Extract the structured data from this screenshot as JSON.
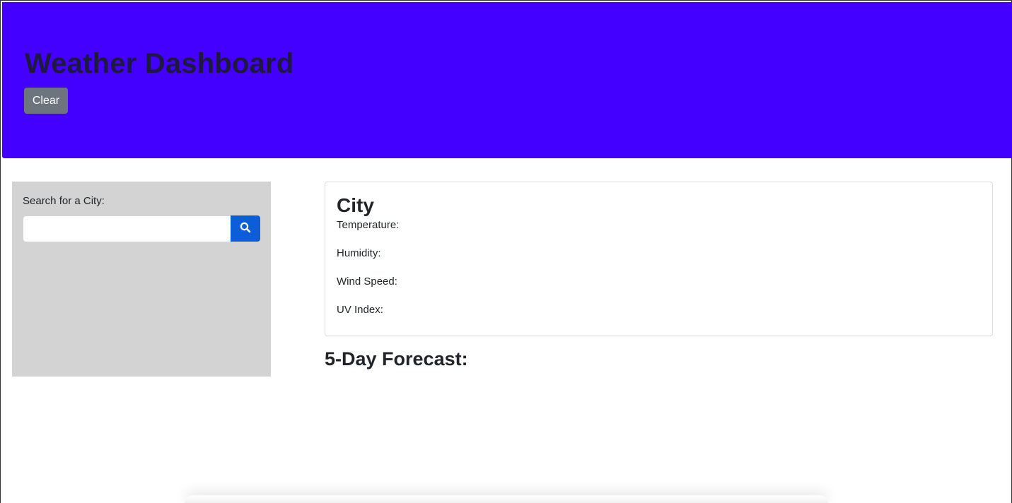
{
  "header": {
    "title": "Weather Dashboard",
    "clear_label": "Clear",
    "background_color": "#4400ff"
  },
  "search": {
    "label": "Search for a City:",
    "input_value": "",
    "placeholder": "",
    "button_icon": "search-icon",
    "panel_color": "#d3d3d3"
  },
  "current_weather": {
    "city": "City",
    "temperature_label": "Temperature:",
    "humidity_label": "Humidity:",
    "wind_speed_label": "Wind Speed:",
    "uv_index_label": "UV Index:"
  },
  "forecast": {
    "title": "5-Day Forecast:"
  }
}
